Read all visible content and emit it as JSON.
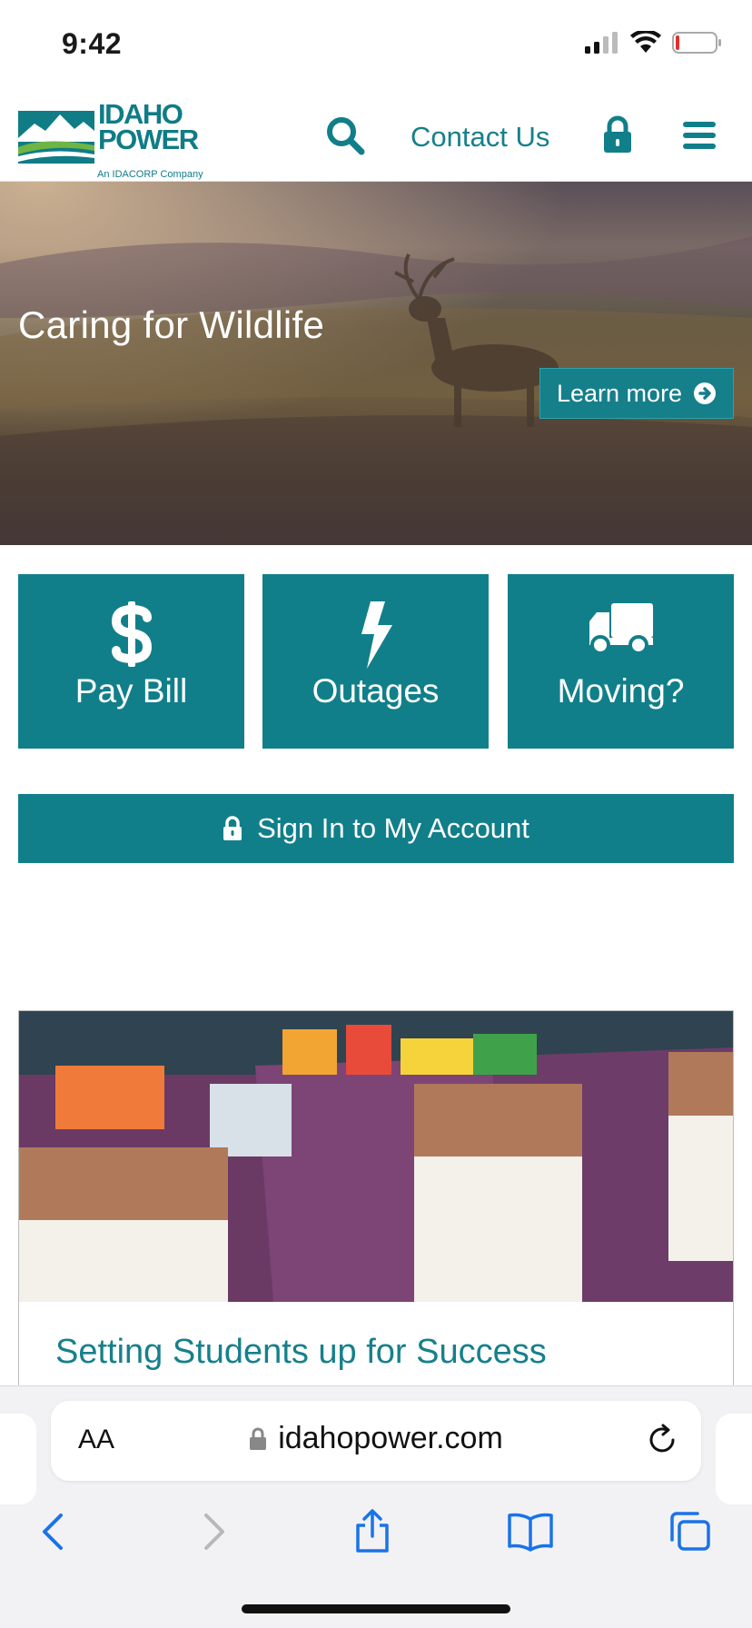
{
  "status_bar": {
    "time": "9:42"
  },
  "header": {
    "logo_line1": "IDAHO",
    "logo_line2": "POWER",
    "logo_sub": "An IDACORP Company",
    "contact_label": "Contact Us",
    "icons": [
      "search-icon",
      "lock-icon",
      "hamburger-menu-icon"
    ]
  },
  "hero": {
    "title": "Caring for Wildlife",
    "button_label": "Learn more",
    "button_icon": "arrow-circle-right-icon"
  },
  "tiles": [
    {
      "label": "Pay Bill",
      "icon": "dollar-icon"
    },
    {
      "label": "Outages",
      "icon": "lightning-bolt-icon"
    },
    {
      "label": "Moving?",
      "icon": "truck-icon"
    }
  ],
  "signin": {
    "label": "Sign In to My Account",
    "icon": "lock-icon"
  },
  "card": {
    "title": "Setting Students up for Success"
  },
  "browser": {
    "aa_label": "AA",
    "url": "idahopower.com",
    "icons": [
      "back-icon",
      "forward-icon",
      "share-icon",
      "bookmarks-icon",
      "tabs-icon"
    ]
  },
  "colors": {
    "brand_teal": "#117f8a",
    "link_teal": "#16808b"
  }
}
